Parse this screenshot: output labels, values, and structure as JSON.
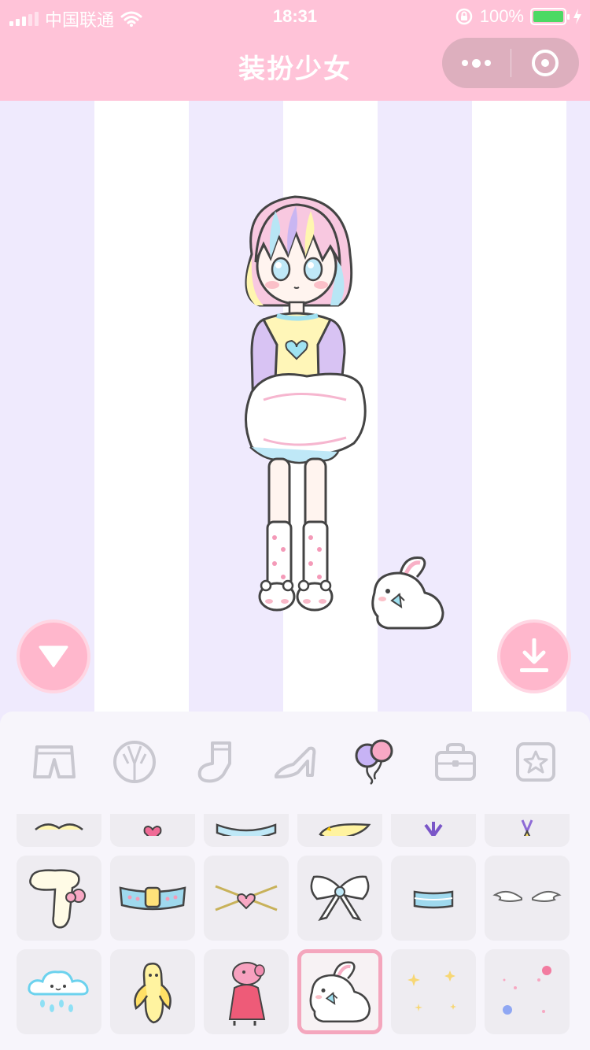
{
  "status_bar": {
    "carrier": "中国联通",
    "time": "18:31",
    "battery": "100%"
  },
  "header": {
    "title": "装扮少女",
    "menu_icon": "more-dots-icon",
    "close_icon": "target-close-icon"
  },
  "colors": {
    "header_bg": "#ffc3d8",
    "stripe_lavender": "#efeafd",
    "button_pink": "#ffb7cc",
    "selected_border": "#f4a6bd"
  },
  "stage": {
    "left_button_icon": "triangle-down-icon",
    "right_button_icon": "download-icon"
  },
  "tabs": [
    {
      "icon": "shorts-icon",
      "active": false
    },
    {
      "icon": "jacket-icon",
      "active": false
    },
    {
      "icon": "sock-icon",
      "active": false
    },
    {
      "icon": "high-heel-icon",
      "active": false
    },
    {
      "icon": "balloons-icon",
      "active": true
    },
    {
      "icon": "bag-icon",
      "active": false
    },
    {
      "icon": "star-badge-icon",
      "active": false
    }
  ],
  "items": [
    {
      "icon": "bow-item-icon",
      "selected": false
    },
    {
      "icon": "heart-clip-icon",
      "selected": false
    },
    {
      "icon": "blue-crown-icon",
      "selected": false
    },
    {
      "icon": "banana-hat-icon",
      "selected": false
    },
    {
      "icon": "purple-ribbon-icon",
      "selected": false
    },
    {
      "icon": "star-medal-icon",
      "selected": false
    },
    {
      "icon": "fluffy-scarf-icon",
      "selected": false
    },
    {
      "icon": "belt-icon",
      "selected": false
    },
    {
      "icon": "heart-necklace-icon",
      "selected": false
    },
    {
      "icon": "white-bow-icon",
      "selected": false
    },
    {
      "icon": "blue-band-icon",
      "selected": false
    },
    {
      "icon": "angel-wings-icon",
      "selected": false
    },
    {
      "icon": "rain-cloud-icon",
      "selected": false
    },
    {
      "icon": "banana-pet-icon",
      "selected": false
    },
    {
      "icon": "pink-pig-icon",
      "selected": false
    },
    {
      "icon": "bunny-pet-icon",
      "selected": true
    },
    {
      "icon": "gold-sparkles-icon",
      "selected": false
    },
    {
      "icon": "flower-sparkles-icon",
      "selected": false
    }
  ]
}
